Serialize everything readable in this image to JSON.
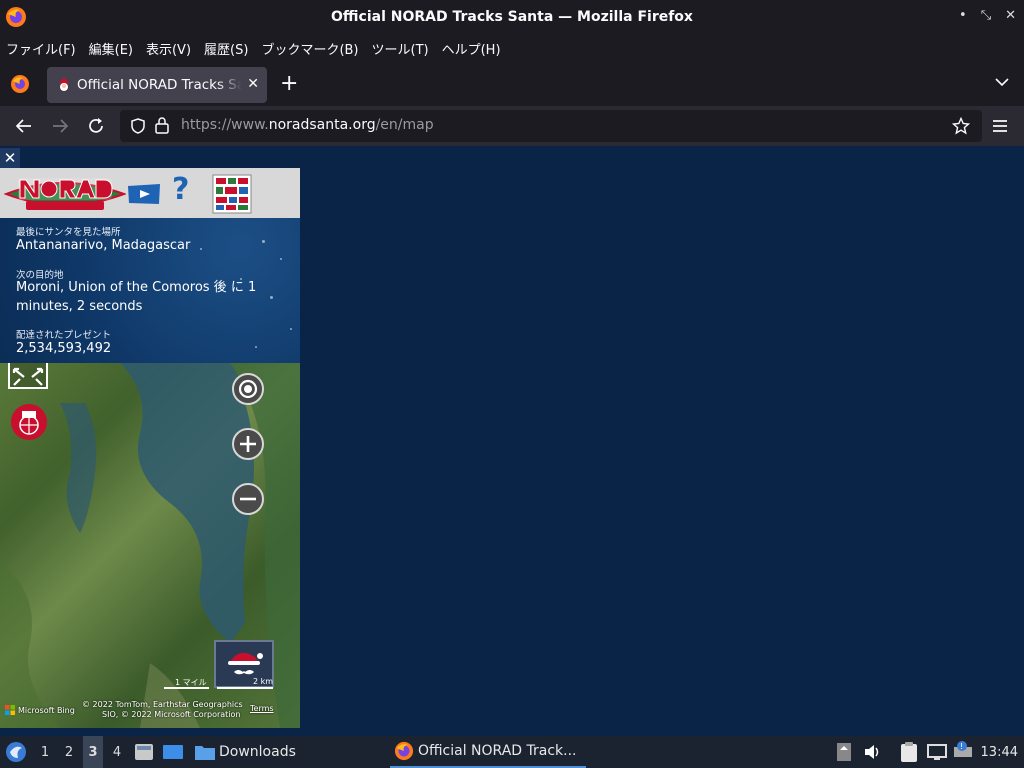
{
  "window": {
    "title": "Official NORAD Tracks Santa — Mozilla Firefox",
    "controls": [
      "minimize-icon",
      "restore-icon",
      "close-icon"
    ]
  },
  "menubar": {
    "items": [
      "ファイル(F)",
      "編集(E)",
      "表示(V)",
      "履歴(S)",
      "ブックマーク(B)",
      "ツール(T)",
      "ヘルプ(H)"
    ]
  },
  "tabs": [
    {
      "title": "Official NORAD Tracks Santa",
      "active": true
    }
  ],
  "navbar": {
    "url_prefix": "https://www.",
    "url_domain": "noradsanta.org",
    "url_path": "/en/map"
  },
  "panel": {
    "close_label": "✕",
    "help_label": "?",
    "last_seen_label": "最後にサンタを見た場所",
    "last_seen_value": "Antananarivo, Madagascar",
    "next_stop_label": "次の目的地",
    "next_stop_value": "Moroni, Union of the Comoros 後 に 1 minutes, 2 seconds",
    "gifts_label": "配達されたプレゼント",
    "gifts_value": "2,534,593,492"
  },
  "map": {
    "scale_left": "1 マイル",
    "scale_right": "2 km",
    "provider": "Microsoft Bing",
    "attribution_1": "© 2022 TomTom, Earthstar Geographics",
    "attribution_2": "SIO, © 2022 Microsoft Corporation",
    "terms": "Terms"
  },
  "taskbar": {
    "workspaces": [
      "1",
      "2",
      "3",
      "4"
    ],
    "active_workspace": "3",
    "folder_label": "Downloads",
    "task_label": "Official NORAD Track...",
    "clock": "13:44"
  },
  "colors": {
    "page_bg": "#0a2447",
    "chrome_bg": "#1c1b22",
    "toolbar_bg": "#2b2a33",
    "accent": "#4f8fd6"
  }
}
